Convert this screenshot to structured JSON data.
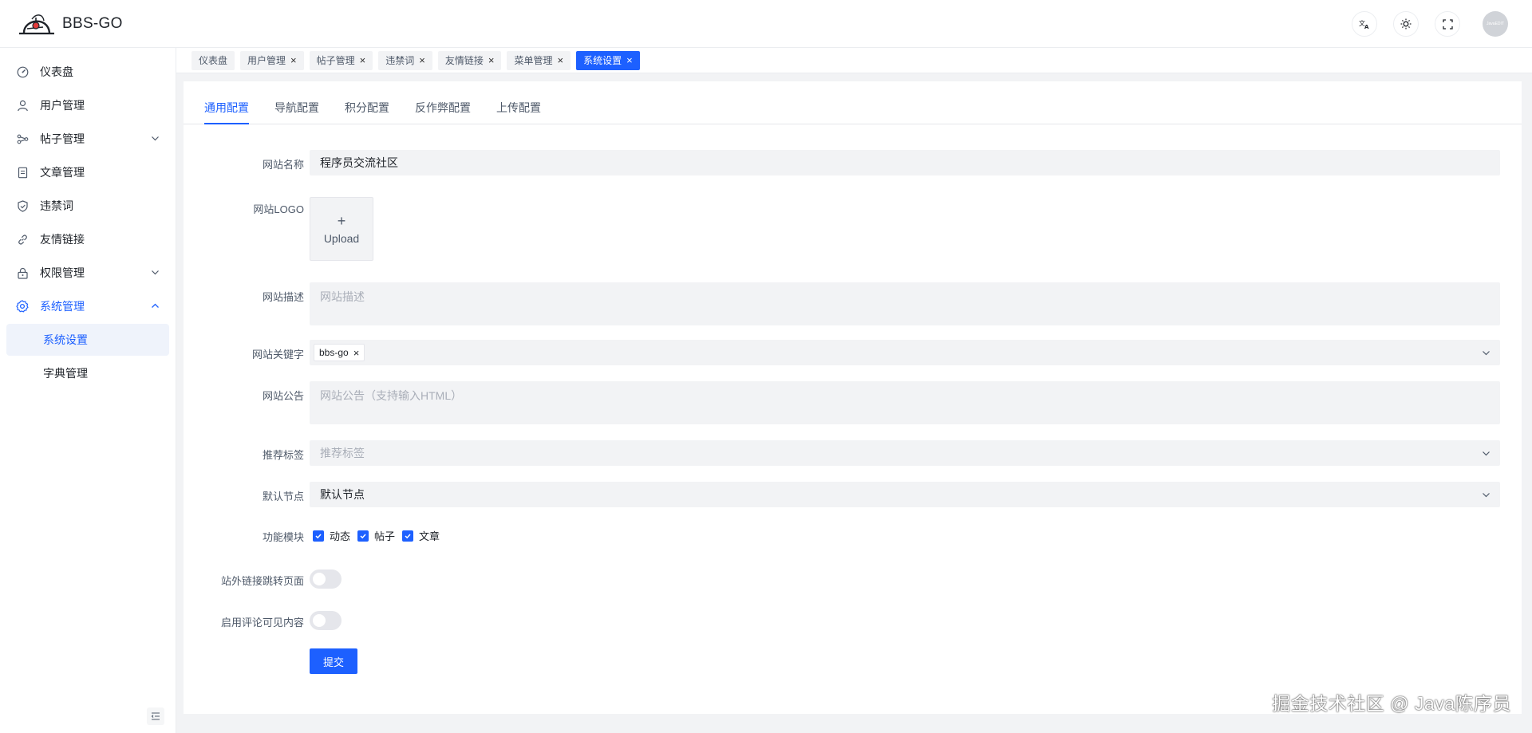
{
  "app": {
    "title": "BBS-GO"
  },
  "header": {
    "avatar_text": "JavaEDIT"
  },
  "sidebar": {
    "items": [
      {
        "label": "仪表盘",
        "icon": "dashboard-icon"
      },
      {
        "label": "用户管理",
        "icon": "user-icon"
      },
      {
        "label": "帖子管理",
        "icon": "share-icon"
      },
      {
        "label": "文章管理",
        "icon": "file-icon"
      },
      {
        "label": "违禁词",
        "icon": "shield-icon"
      },
      {
        "label": "友情链接",
        "icon": "link-icon"
      },
      {
        "label": "权限管理",
        "icon": "lock-icon"
      },
      {
        "label": "系统管理",
        "icon": "gear-icon"
      },
      {
        "label": "系统设置"
      },
      {
        "label": "字典管理"
      }
    ]
  },
  "tabs": [
    {
      "label": "仪表盘",
      "closable": false
    },
    {
      "label": "用户管理",
      "closable": true
    },
    {
      "label": "帖子管理",
      "closable": true
    },
    {
      "label": "违禁词",
      "closable": true
    },
    {
      "label": "友情链接",
      "closable": true
    },
    {
      "label": "菜单管理",
      "closable": true
    },
    {
      "label": "系统设置",
      "closable": true,
      "active": true
    }
  ],
  "config_tabs": [
    "通用配置",
    "导航配置",
    "积分配置",
    "反作弊配置",
    "上传配置"
  ],
  "form": {
    "site_name": {
      "label": "网站名称",
      "value": "程序员交流社区"
    },
    "site_logo": {
      "label": "网站LOGO",
      "upload_label": "Upload"
    },
    "site_desc": {
      "label": "网站描述",
      "placeholder": "网站描述"
    },
    "site_keywords": {
      "label": "网站关键字",
      "tags": [
        "bbs-go"
      ]
    },
    "site_notice": {
      "label": "网站公告",
      "placeholder": "网站公告（支持输入HTML）"
    },
    "recommend_tags": {
      "label": "推荐标签",
      "placeholder": "推荐标签"
    },
    "default_node": {
      "label": "默认节点",
      "value": "默认节点"
    },
    "modules": {
      "label": "功能模块",
      "options": [
        "动态",
        "帖子",
        "文章"
      ],
      "checked": [
        true,
        true,
        true
      ]
    },
    "external_link_redirect": {
      "label": "站外链接跳转页面",
      "enabled": false
    },
    "comment_visible": {
      "label": "启用评论可见内容",
      "enabled": false
    },
    "submit_label": "提交"
  },
  "watermark": "掘金技术社区 @ Java陈序员",
  "colors": {
    "primary": "#1d60ff",
    "field_bg": "#f2f3f5",
    "page_bg": "#f2f3f5"
  }
}
